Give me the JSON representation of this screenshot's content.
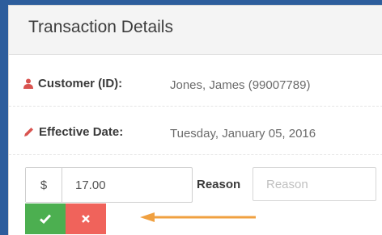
{
  "panel": {
    "title": "Transaction Details"
  },
  "customer": {
    "label": "Customer (ID):",
    "value": "Jones, James (99007789)",
    "icon": "user-icon"
  },
  "effective_date": {
    "label": "Effective Date:",
    "value": "Tuesday, January 05, 2016",
    "icon": "pencil-icon"
  },
  "amount": {
    "currency": "$",
    "value": "17.00"
  },
  "reason": {
    "label": "Reason",
    "placeholder": "Reason"
  },
  "actions": {
    "confirm_icon": "check-icon",
    "cancel_icon": "x-icon"
  },
  "colors": {
    "confirm": "#4caf50",
    "cancel": "#f0635b",
    "arrow": "#f0a040",
    "icon_red": "#d9534f"
  }
}
